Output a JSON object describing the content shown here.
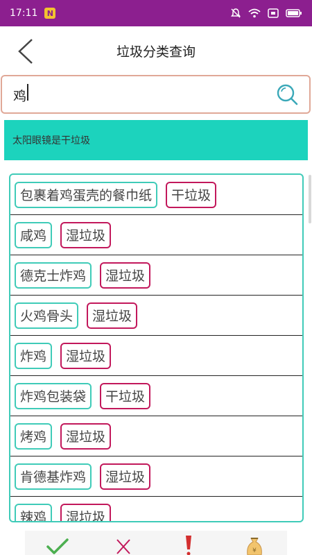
{
  "status": {
    "time": "17:11",
    "notif_glyph": "N"
  },
  "header": {
    "title": "垃圾分类查询"
  },
  "search": {
    "value": "鸡"
  },
  "result": {
    "message": "太阳眼镜是干垃圾"
  },
  "items": [
    {
      "name": "包裹着鸡蛋壳的餐巾纸",
      "category": "干垃圾"
    },
    {
      "name": "咸鸡",
      "category": "湿垃圾"
    },
    {
      "name": "德克士炸鸡",
      "category": "湿垃圾"
    },
    {
      "name": "火鸡骨头",
      "category": "湿垃圾"
    },
    {
      "name": "炸鸡",
      "category": "湿垃圾"
    },
    {
      "name": "炸鸡包装袋",
      "category": "干垃圾"
    },
    {
      "name": "烤鸡",
      "category": "湿垃圾"
    },
    {
      "name": "肯德基炸鸡",
      "category": "湿垃圾"
    },
    {
      "name": "辣鸡",
      "category": "湿垃圾"
    }
  ],
  "colors": {
    "statusbar": "#8c1f8f",
    "banner": "#1cd3bd",
    "name_border": "#3fcbb8",
    "category_border": "#c2185b",
    "search_border": "#e0a897"
  },
  "icons": {
    "back": "chevron-left-icon",
    "search": "search-icon",
    "nav": [
      "check-icon",
      "cross-icon",
      "exclamation-icon",
      "money-bag-icon"
    ]
  }
}
